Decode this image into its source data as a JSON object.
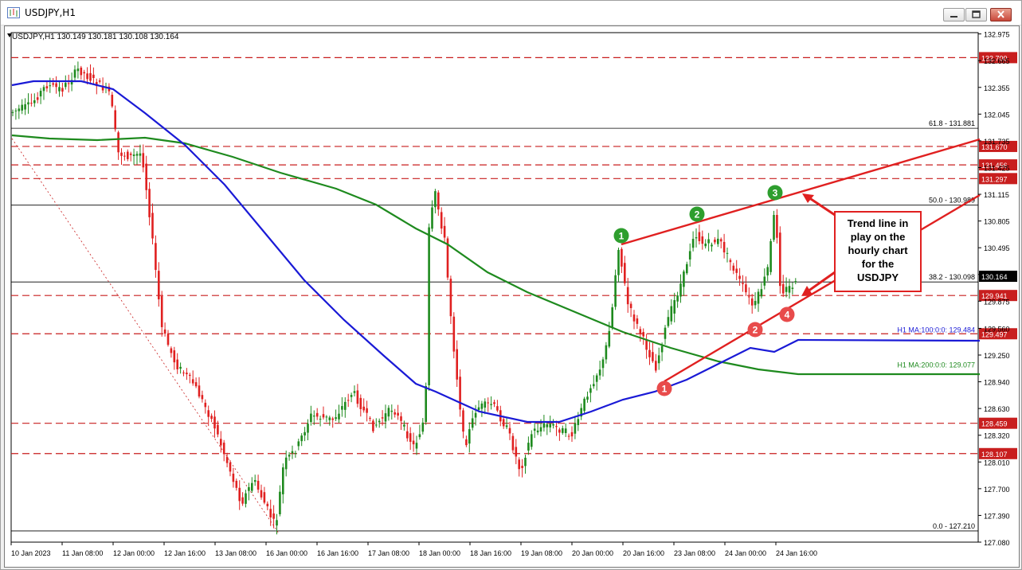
{
  "window": {
    "title": "USDJPY,H1",
    "buttons": [
      "minimize",
      "restore",
      "close"
    ]
  },
  "chart_data": {
    "type": "candlestick",
    "symbol_info": "USDJPY,H1  130.149 130.181 130.108 130.164",
    "price_axis_ticks": [
      "132.975",
      "132.665",
      "132.355",
      "132.045",
      "131.735",
      "131.425",
      "131.115",
      "130.805",
      "130.495",
      "130.185",
      "129.875",
      "129.560",
      "129.250",
      "128.940",
      "128.630",
      "128.320",
      "128.010",
      "127.700",
      "127.390",
      "127.080"
    ],
    "time_axis_ticks": [
      "10 Jan 2023",
      "11 Jan 08:00",
      "12 Jan 00:00",
      "12 Jan 16:00",
      "13 Jan 08:00",
      "16 Jan 00:00",
      "16 Jan 16:00",
      "17 Jan 08:00",
      "18 Jan 00:00",
      "18 Jan 16:00",
      "19 Jan 08:00",
      "20 Jan 00:00",
      "20 Jan 16:00",
      "23 Jan 08:00",
      "24 Jan 00:00",
      "24 Jan 16:00"
    ],
    "y_range": [
      127.08,
      132.99
    ],
    "current_price": "130.164",
    "horizontal_levels": [
      {
        "price": 132.7,
        "label": "132.700"
      },
      {
        "price": 131.67,
        "label": "131.670"
      },
      {
        "price": 131.456,
        "label": "131.456"
      },
      {
        "price": 131.297,
        "label": "131.297"
      },
      {
        "price": 129.941,
        "label": "129.941"
      },
      {
        "price": 129.497,
        "label": "129.497"
      },
      {
        "price": 128.459,
        "label": "128.459"
      },
      {
        "price": 128.107,
        "label": "128.107"
      }
    ],
    "fibonacci_levels": [
      {
        "price": 131.881,
        "label": "61.8 - 131.881"
      },
      {
        "price": 130.989,
        "label": "50.0 - 130.989"
      },
      {
        "price": 130.098,
        "label": "38.2 - 130.098"
      },
      {
        "price": 127.21,
        "label": "0.0 - 127.210"
      }
    ],
    "moving_averages": [
      {
        "name": "H1 MA:100:0:0",
        "label": "H1 MA:100:0:0: 129.484",
        "color": "#1a1ad6",
        "last": 129.484
      },
      {
        "name": "H1 MA:200:0:0",
        "label": "H1 MA:200:0:0: 129.077",
        "color": "#1e8a1e",
        "last": 129.077
      }
    ],
    "markers": [
      {
        "label": "1",
        "color": "#2e9e2e"
      },
      {
        "label": "2",
        "color": "#2e9e2e"
      },
      {
        "label": "3",
        "color": "#2e9e2e"
      },
      {
        "label": "1",
        "color": "#e84b4b"
      },
      {
        "label": "2",
        "color": "#e84b4b"
      },
      {
        "label": "4",
        "color": "#e84b4b"
      }
    ],
    "annotation": {
      "lines": [
        "Trend line in",
        "play on the",
        "hourly chart",
        "for the",
        "USDJPY"
      ]
    },
    "colors": {
      "bull": "#1e8a1e",
      "bear": "#e02020",
      "levels": "#c81e1e",
      "trend": "#e02020"
    }
  }
}
